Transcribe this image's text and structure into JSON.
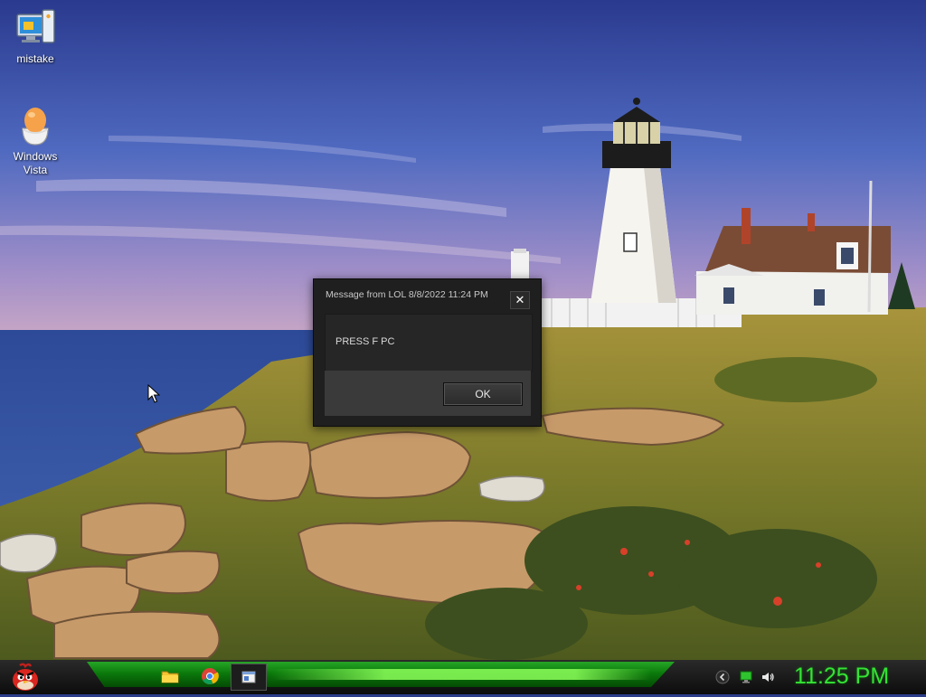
{
  "desktop": {
    "icons": [
      {
        "label": "mistake",
        "icon": "computer-icon"
      },
      {
        "label": "Windows\nVista",
        "icon": "egg-icon"
      }
    ]
  },
  "dialog": {
    "title": "Message from LOL 8/8/2022 11:24 PM",
    "message": "PRESS F PC",
    "ok_label": "OK",
    "close_icon": "close-icon"
  },
  "taskbar": {
    "start_icon": "angry-bird-icon",
    "pinned": [
      {
        "icon": "folder-icon"
      },
      {
        "icon": "chrome-icon"
      },
      {
        "icon": "window-icon"
      }
    ],
    "tray": [
      {
        "icon": "chevron-icon"
      },
      {
        "icon": "network-icon"
      },
      {
        "icon": "speaker-icon"
      }
    ],
    "clock": "11:25 PM",
    "colors": {
      "accent": "#35e335",
      "band": "#0b7a0b"
    }
  }
}
